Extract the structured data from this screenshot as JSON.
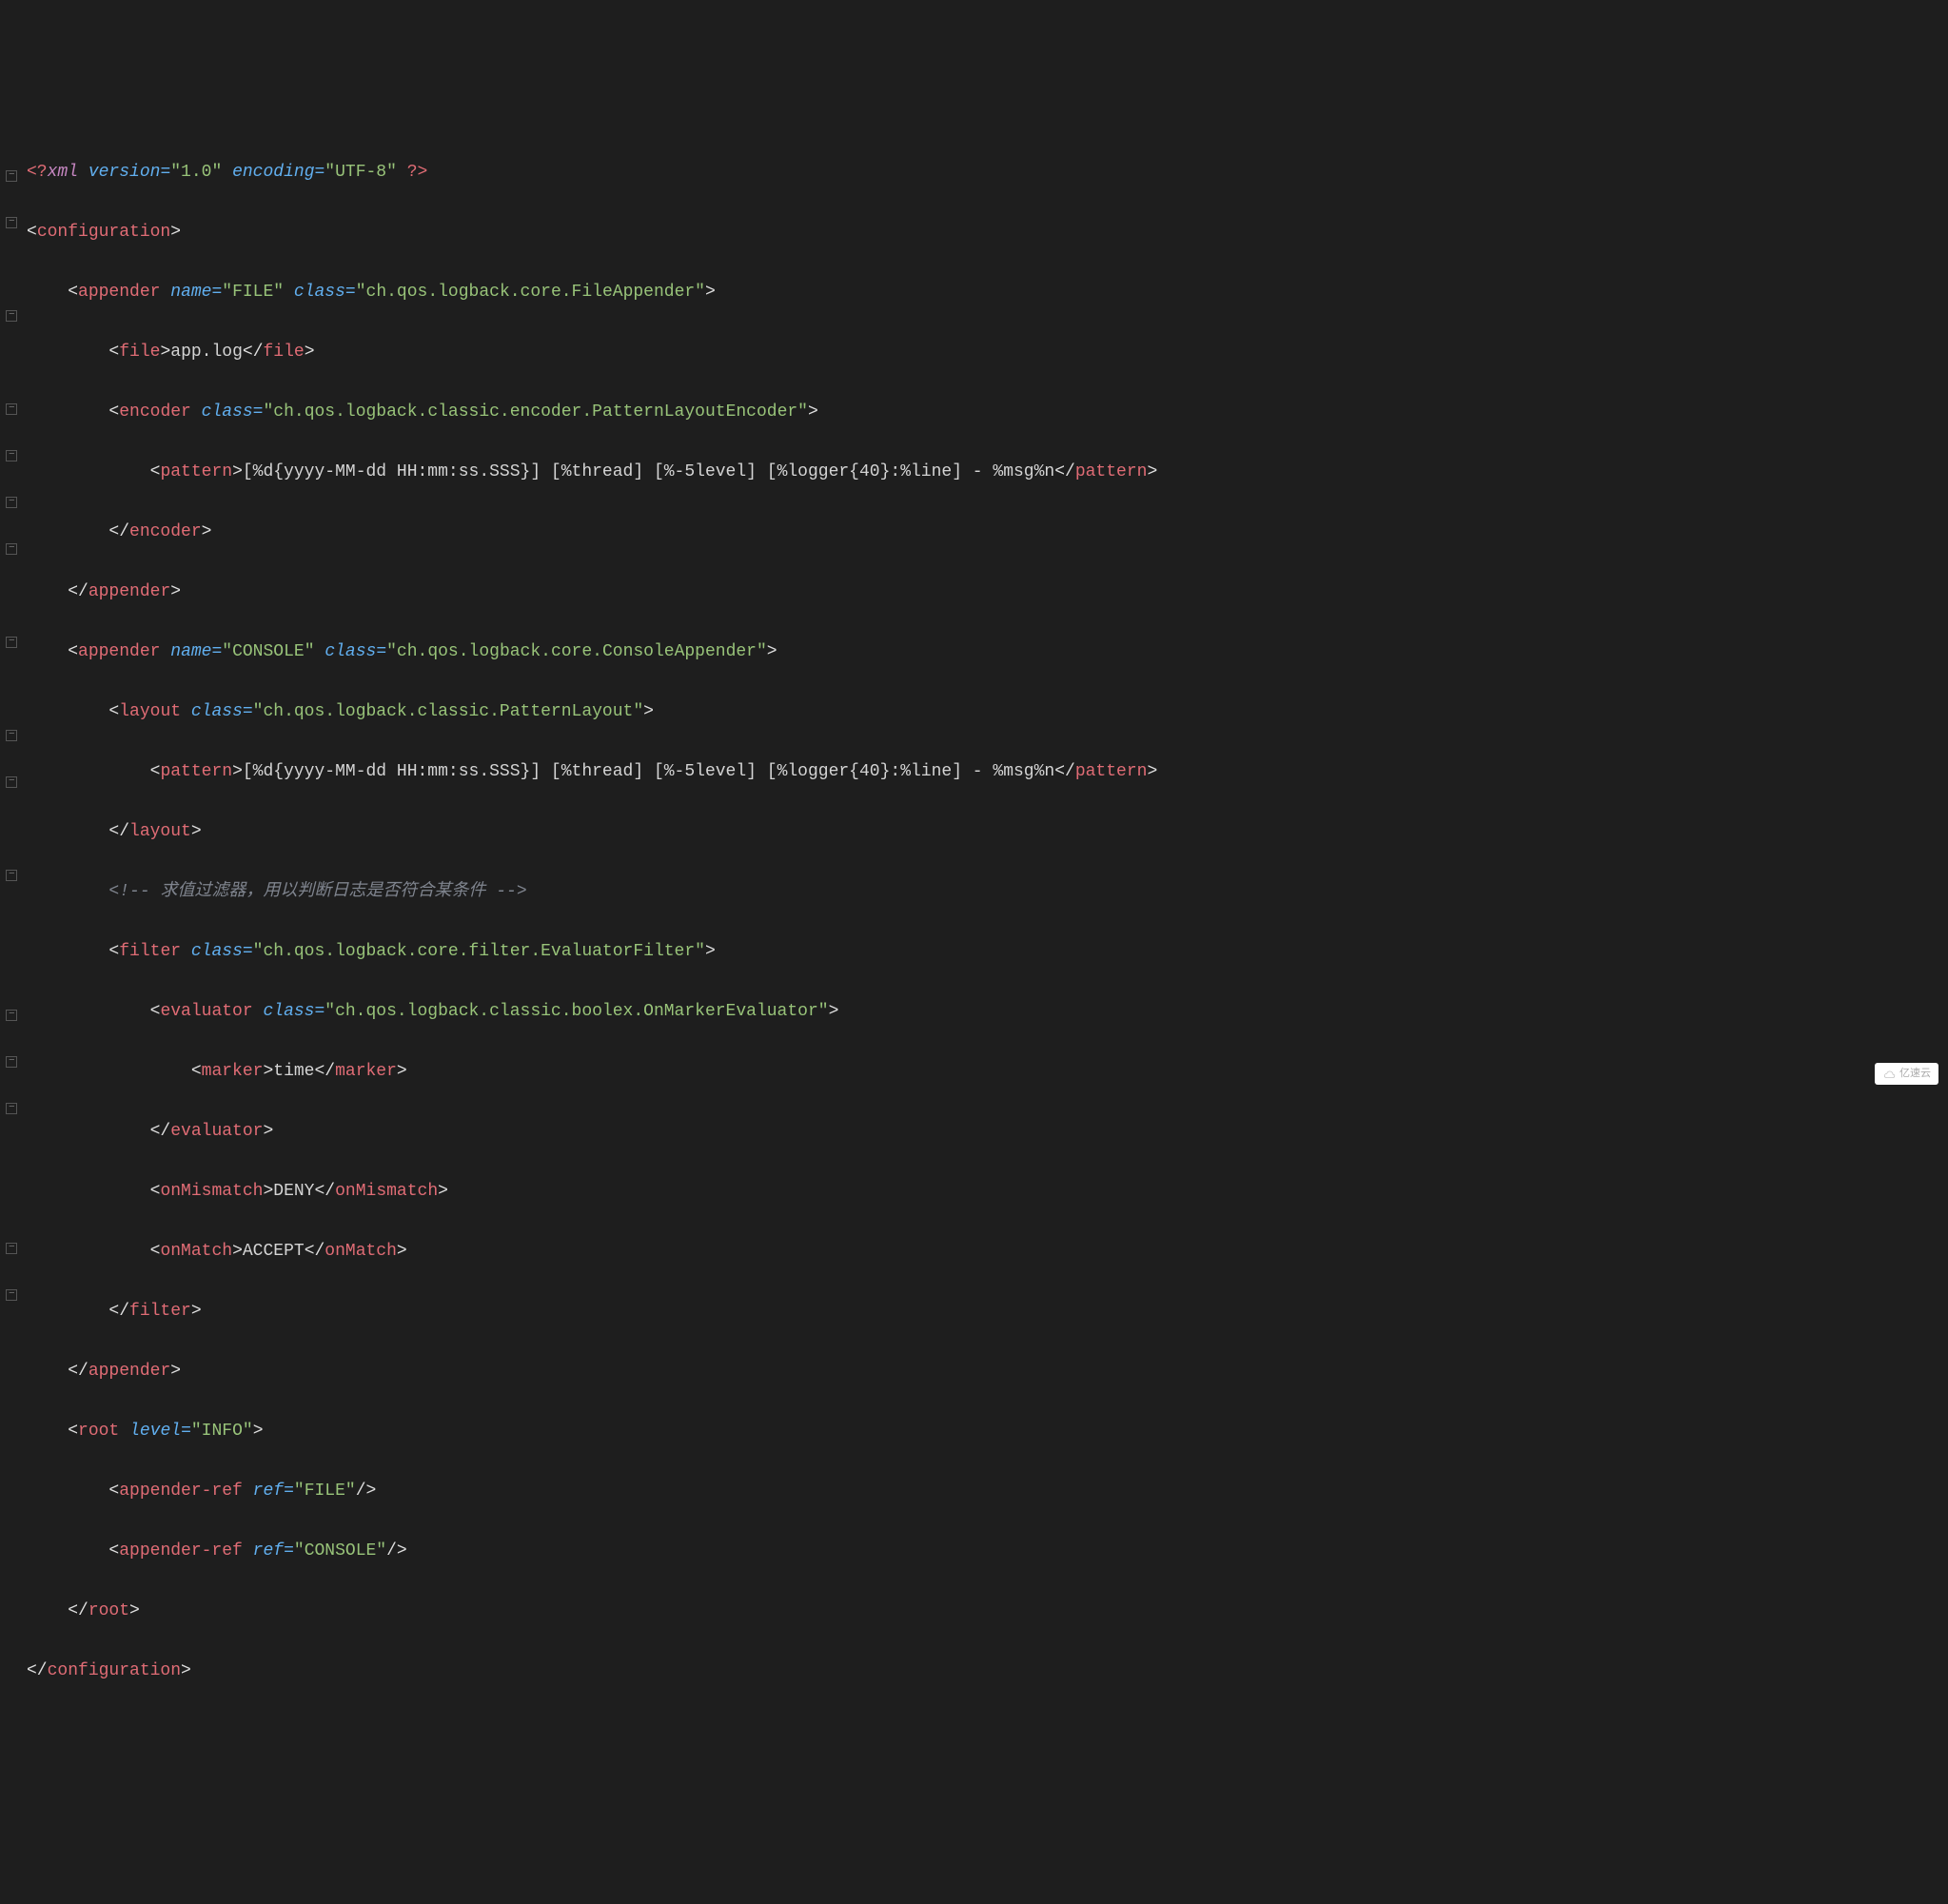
{
  "lines": [
    "l0",
    "l1",
    "l2",
    "l3",
    "l4",
    "l5",
    "l6",
    "l7",
    "l8",
    "l9",
    "l10",
    "l11",
    "l12",
    "l13",
    "l14",
    "l15",
    "l16",
    "l17",
    "l18",
    "l19",
    "l20",
    "l21",
    "l22",
    "l23",
    "l24",
    "l25"
  ],
  "tokens": {
    "xml_decl_open": "<?",
    "xml_decl_name": "xml ",
    "xml_decl_close": "?>",
    "attr_version": "version=",
    "val_version": "\"1.0\"",
    "attr_encoding": "encoding=",
    "val_encoding": "\"UTF-8\"",
    "lt": "<",
    "lt_close": "</",
    "gt": ">",
    "slash_gt": "/>",
    "sp": " ",
    "tag_configuration": "configuration",
    "tag_appender": "appender",
    "tag_file": "file",
    "tag_encoder": "encoder",
    "tag_pattern": "pattern",
    "tag_layout": "layout",
    "tag_filter": "filter",
    "tag_evaluator": "evaluator",
    "tag_marker": "marker",
    "tag_onMismatch": "onMismatch",
    "tag_onMatch": "onMatch",
    "tag_root": "root",
    "tag_appender_ref": "appender-ref",
    "attr_name": "name=",
    "attr_class": "class=",
    "attr_level": "level=",
    "attr_ref": "ref=",
    "val_FILE": "\"FILE\"",
    "val_file_appender": "\"ch.qos.logback.core.FileAppender\"",
    "val_pattern_encoder": "\"ch.qos.logback.classic.encoder.PatternLayoutEncoder\"",
    "val_CONSOLE": "\"CONSOLE\"",
    "val_console_appender": "\"ch.qos.logback.core.ConsoleAppender\"",
    "val_pattern_layout": "\"ch.qos.logback.classic.PatternLayout\"",
    "val_eval_filter": "\"ch.qos.logback.core.filter.EvaluatorFilter\"",
    "val_marker_eval": "\"ch.qos.logback.classic.boolex.OnMarkerEvaluator\"",
    "val_INFO": "\"INFO\"",
    "txt_app_log": "app.log",
    "txt_pattern": "[%d{yyyy-MM-dd HH:mm:ss.SSS}] [%thread] [%-5level] [%logger{40}:%line] - %msg%n",
    "txt_time": "time",
    "txt_deny": "DENY",
    "txt_accept": "ACCEPT",
    "comment_open": "<!-- ",
    "comment_text": "求值过滤器，用以判断日志是否符合某条件",
    "comment_close": " -->"
  },
  "indent": {
    "i1": "    ",
    "i2": "        ",
    "i3": "            ",
    "i4": "                "
  },
  "watermark": "亿速云"
}
